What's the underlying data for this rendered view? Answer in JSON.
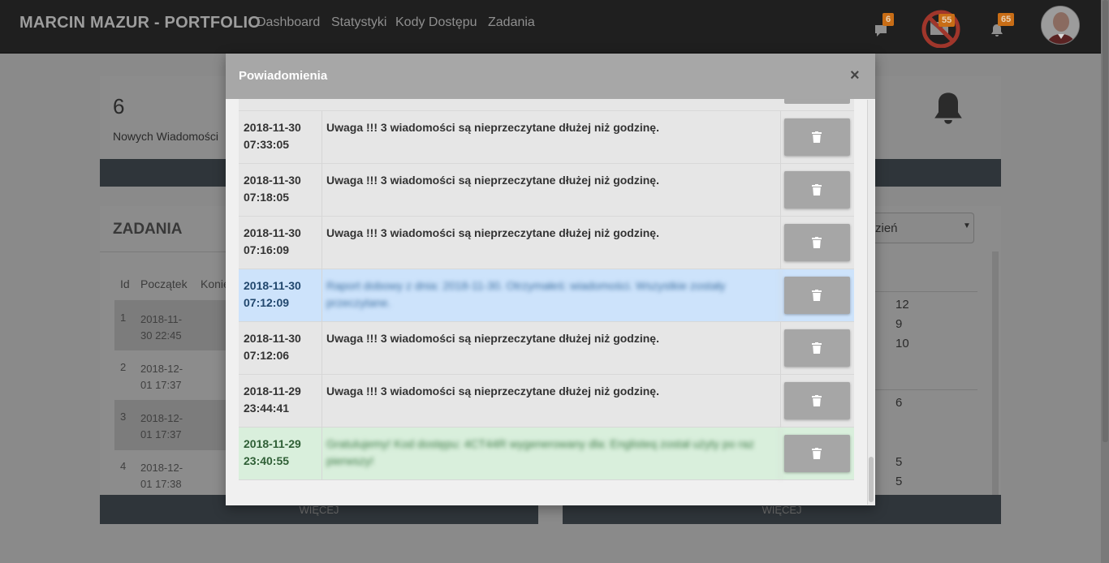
{
  "navbar": {
    "brand": "MARCIN MAZUR - PORTFOLIO",
    "links": [
      "Dashboard",
      "Statystyki",
      "Kody Dostępu",
      "Zadania"
    ],
    "messages_badge": "6",
    "blocked_badge": "55",
    "notifications_badge": "65"
  },
  "background": {
    "messages_card": {
      "count": "6",
      "label": "Nowych Wiadomości"
    },
    "tasks_card": {
      "title": "ZADANIA",
      "columns": [
        "Id",
        "Początek",
        "Konie"
      ],
      "rows": [
        {
          "id": "1",
          "start_line1": "2018-11-",
          "start_line2": "30 22:45"
        },
        {
          "id": "2",
          "start_line1": "2018-12-",
          "start_line2": "01 17:37"
        },
        {
          "id": "3",
          "start_line1": "2018-12-",
          "start_line2": "01 17:37"
        },
        {
          "id": "4",
          "start_line1": "2018-12-",
          "start_line2": "01 17:38"
        }
      ],
      "more_button": "WIĘCEJ"
    },
    "stats_card": {
      "select_value": "zień",
      "values": [
        "12",
        "9",
        "10",
        "6",
        "5",
        "5"
      ],
      "more_button": "WIĘCEJ"
    }
  },
  "modal": {
    "title": "Powiadomienia",
    "close_symbol": "×",
    "notifications": [
      {
        "date": "2018-11-30",
        "time": "07:33:05",
        "message": "Uwaga !!! 3 wiadomości są nieprzeczytane dłużej niż godzinę.",
        "variant": "default"
      },
      {
        "date": "2018-11-30",
        "time": "07:18:05",
        "message": "Uwaga !!! 3 wiadomości są nieprzeczytane dłużej niż godzinę.",
        "variant": "default"
      },
      {
        "date": "2018-11-30",
        "time": "07:16:09",
        "message": "Uwaga !!! 3 wiadomości są nieprzeczytane dłużej niż godzinę.",
        "variant": "default"
      },
      {
        "date": "2018-11-30",
        "time": "07:12:09",
        "message": "Raport dobowy z dnia: 2018-11-30. Otrzymałeś: wiadomości. Wszystkie zostały przeczytane.",
        "variant": "info"
      },
      {
        "date": "2018-11-30",
        "time": "07:12:06",
        "message": "Uwaga !!! 3 wiadomości są nieprzeczytane dłużej niż godzinę.",
        "variant": "default"
      },
      {
        "date": "2018-11-29",
        "time": "23:44:41",
        "message": "Uwaga !!! 3 wiadomości są nieprzeczytane dłużej niż godzinę.",
        "variant": "default"
      },
      {
        "date": "2018-11-29",
        "time": "23:40:55",
        "message": "Gratulujemy! Kod dostępu: 4CT44R wygenerowany dla: Englisteq został użyty po raz pierwszy!",
        "variant": "success"
      }
    ]
  },
  "colors": {
    "navbar_bg": "#1f1f1f",
    "badge": "#c86d16",
    "modal_header": "#a7a7a7",
    "info_row": "#cde3fb",
    "success_row": "#d9efdc",
    "delete_button": "#a6a6a6"
  }
}
